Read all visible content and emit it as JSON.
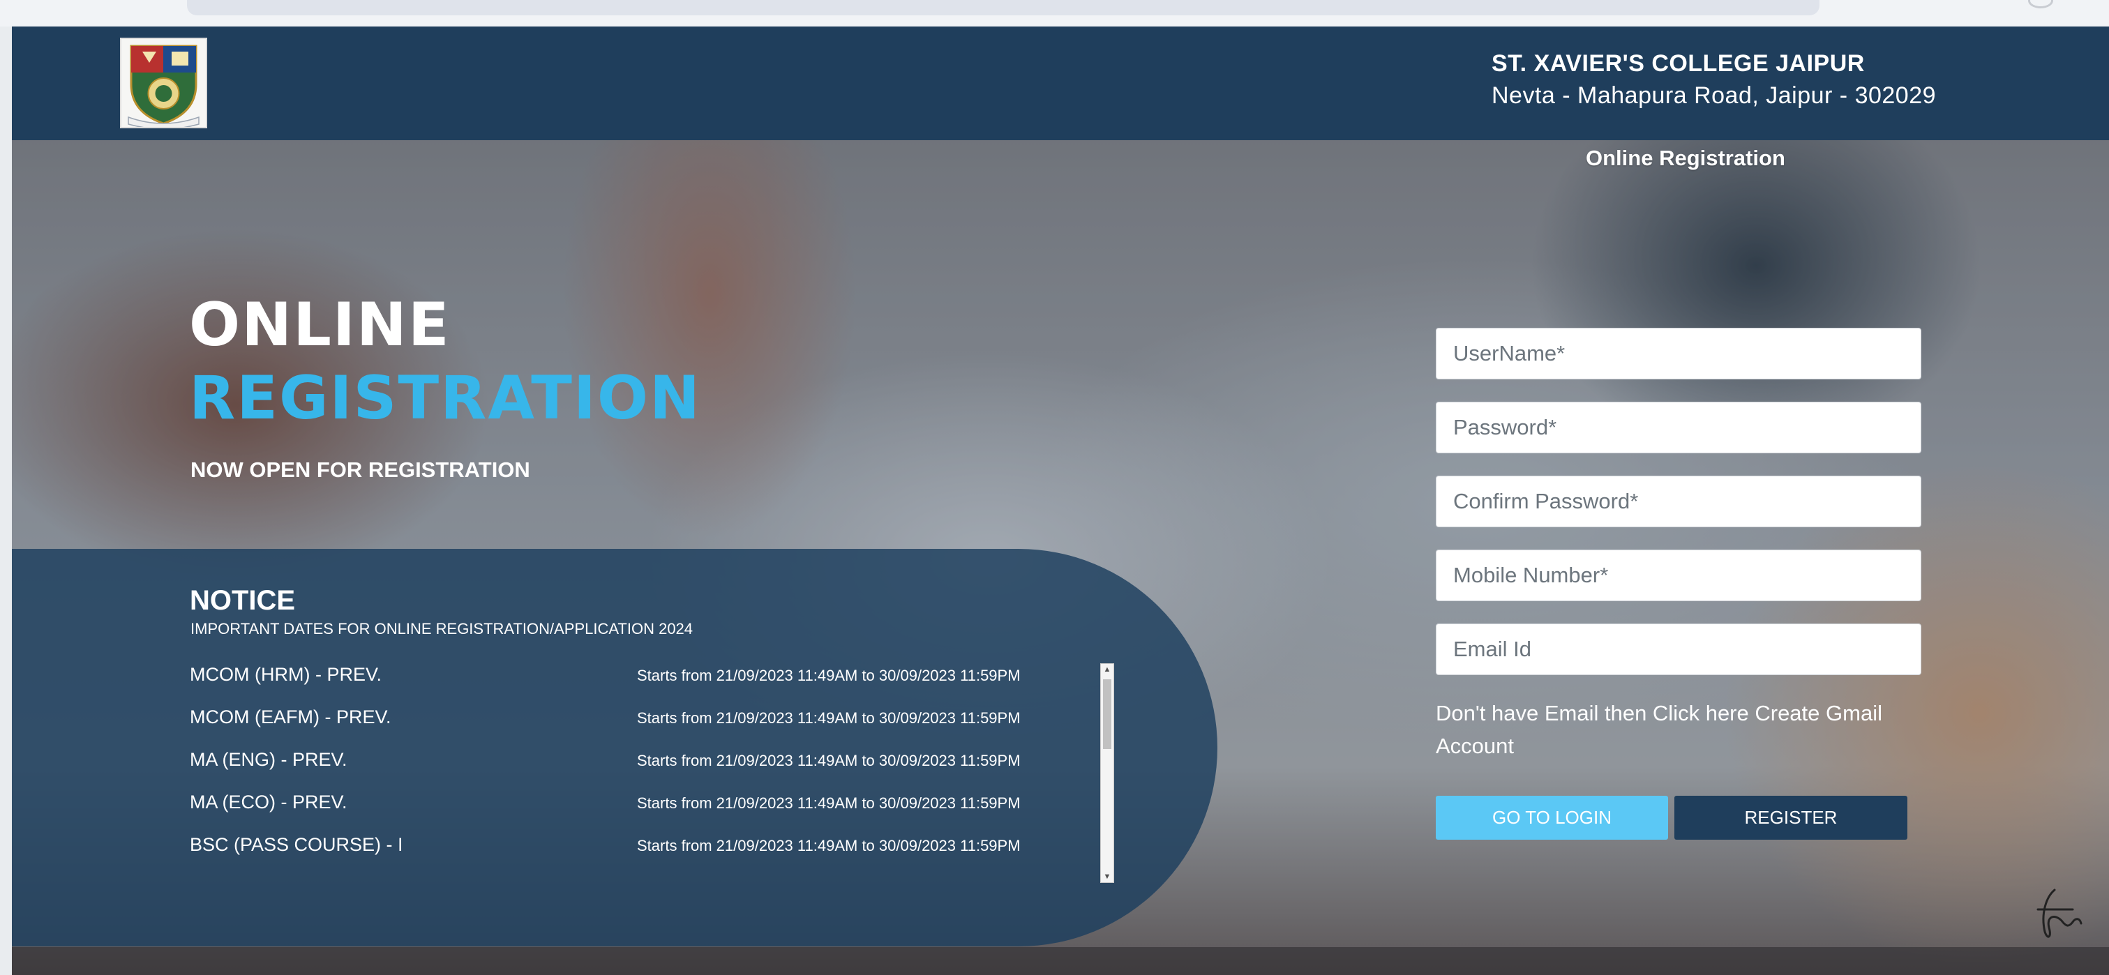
{
  "header": {
    "college_name": "ST. XAVIER'S COLLEGE JAIPUR",
    "college_address": "Nevta - Mahapura Road, Jaipur - 302029"
  },
  "hero": {
    "title_line1": "ONLINE",
    "title_line2": "REGISTRATION",
    "tagline": "NOW OPEN FOR REGISTRATION"
  },
  "notice": {
    "title": "NOTICE",
    "subtitle": "IMPORTANT DATES FOR ONLINE REGISTRATION/APPLICATION 2024",
    "items": [
      {
        "course": "MCOM (HRM) - PREV.",
        "dates": "Starts from 21/09/2023 11:49AM to 30/09/2023 11:59PM"
      },
      {
        "course": "MCOM (EAFM) - PREV.",
        "dates": "Starts from 21/09/2023 11:49AM to 30/09/2023 11:59PM"
      },
      {
        "course": "MA (ENG) - PREV.",
        "dates": "Starts from 21/09/2023 11:49AM to 30/09/2023 11:59PM"
      },
      {
        "course": "MA (ECO) - PREV.",
        "dates": "Starts from 21/09/2023 11:49AM to 30/09/2023 11:59PM"
      },
      {
        "course": "BSC (PASS COURSE) - I",
        "dates": "Starts from 21/09/2023 11:49AM to 30/09/2023 11:59PM"
      }
    ]
  },
  "form": {
    "subtitle": "Online Registration",
    "username_placeholder": "UserName*",
    "password_placeholder": "Password*",
    "confirm_password_placeholder": "Confirm Password*",
    "mobile_placeholder": "Mobile Number*",
    "email_placeholder": "Email Id",
    "gmail_note": "Don't have Email then Click here Create Gmail Account",
    "login_button": "GO TO LOGIN",
    "register_button": "REGISTER"
  },
  "icons": {
    "logo": "college-crest-icon",
    "signature": "signature-icon"
  },
  "colors": {
    "header_bg": "#1f3e5c",
    "accent_blue": "#37b6ea",
    "login_button": "#5bc8f5",
    "register_button": "#1f3e5c"
  }
}
